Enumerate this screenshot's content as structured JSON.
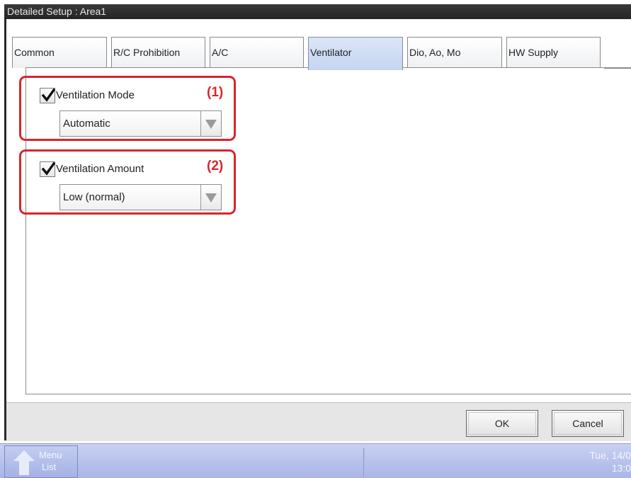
{
  "window": {
    "title": "Detailed Setup : Area1"
  },
  "tabs": [
    {
      "label": "Common",
      "active": false
    },
    {
      "label": "R/C Prohibition",
      "active": false
    },
    {
      "label": "A/C",
      "active": false
    },
    {
      "label": "Ventilator",
      "active": true
    },
    {
      "label": "Dio, Ao, Mo",
      "active": false
    },
    {
      "label": "HW Supply",
      "active": false
    }
  ],
  "settings": [
    {
      "marker": "(1)",
      "label": "Ventilation Mode",
      "checked": true,
      "value": "Automatic"
    },
    {
      "marker": "(2)",
      "label": "Ventilation Amount",
      "checked": true,
      "value": "Low (normal)"
    }
  ],
  "footer": {
    "ok_label": "OK",
    "cancel_label": "Cancel"
  },
  "taskbar": {
    "menu_label_line1": "Menu",
    "menu_label_line2": "List",
    "date": "Tue, 14/0",
    "time": "13:0"
  },
  "colors": {
    "highlight_border": "#d9252e",
    "active_tab": "#c3d5f1",
    "taskbar": "#a9b5e6",
    "titlebar": "#2a2a2a"
  },
  "icons": [
    "check-icon",
    "dropdown-arrow-icon",
    "up-arrow-icon"
  ]
}
